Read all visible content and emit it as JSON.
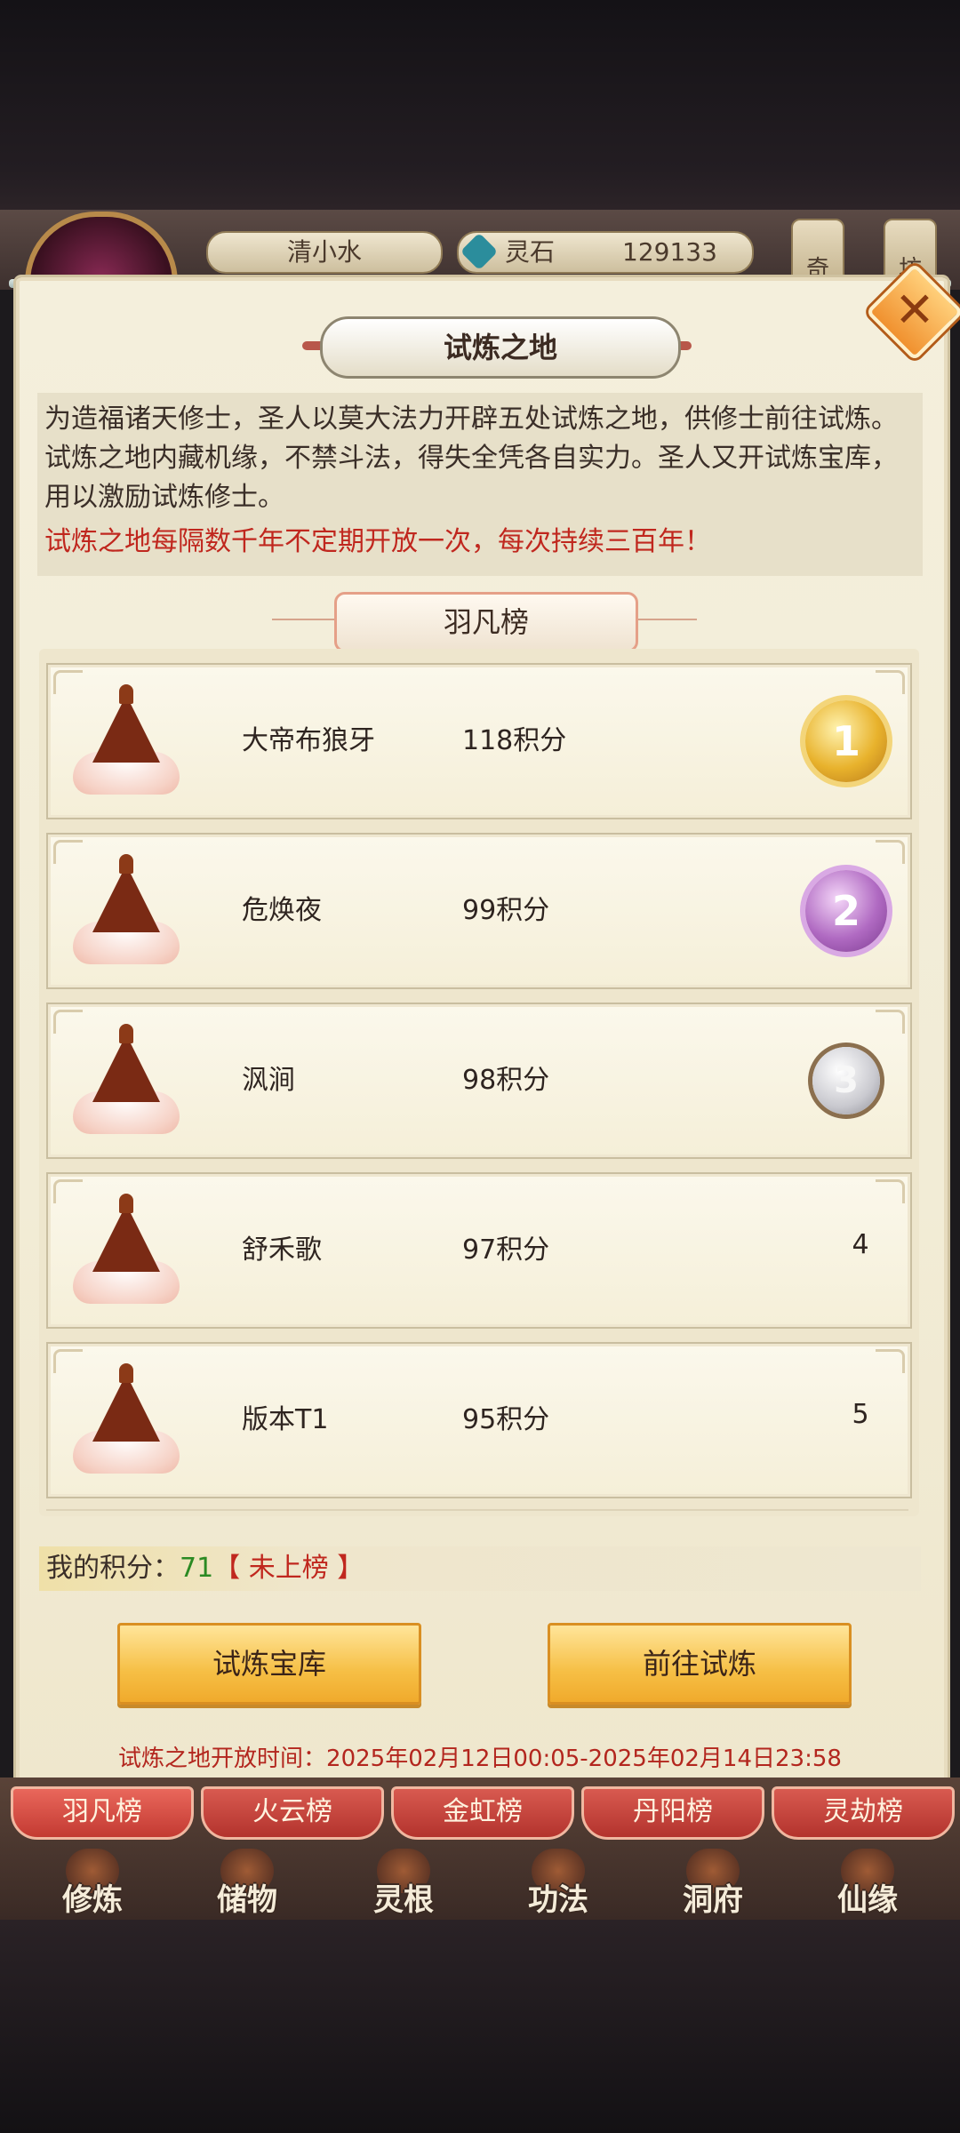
{
  "hud": {
    "player_name": "清小水",
    "currency_label": "灵石",
    "currency_value": "129133",
    "side_tabs": [
      "奇",
      "坊"
    ]
  },
  "modal": {
    "title": "试炼之地",
    "description": "为造福诸天修士，圣人以莫大法力开辟五处试炼之地，供修士前往试炼。试炼之地内藏机缘，不禁斗法，得失全凭各自实力。圣人又开试炼宝库，用以激励试炼修士。",
    "note": "试炼之地每隔数千年不定期开放一次，每次持续三百年！",
    "ranking_title": "羽凡榜",
    "rankings": [
      {
        "name": "大帝布狼牙",
        "score": "118积分",
        "rank": "1",
        "medal": "gold"
      },
      {
        "name": "危焕夜",
        "score": "99积分",
        "rank": "2",
        "medal": "purple"
      },
      {
        "name": "沨涧",
        "score": "98积分",
        "rank": "3",
        "medal": "silver"
      },
      {
        "name": "舒禾歌",
        "score": "97积分",
        "rank": "4",
        "medal": "none"
      },
      {
        "name": "版本T1",
        "score": "95积分",
        "rank": "5",
        "medal": "none"
      }
    ],
    "my_score_label": "我的积分：",
    "my_score_value": "71",
    "my_status": "【 未上榜 】",
    "buttons": {
      "treasury": "试炼宝库",
      "go_trial": "前往试炼"
    },
    "open_time": "试炼之地开放时间：2025年02月12日00:05-2025年02月14日23:58"
  },
  "board_tabs": [
    "羽凡榜",
    "火云榜",
    "金虹榜",
    "丹阳榜",
    "灵劫榜"
  ],
  "nav": [
    "修炼",
    "储物",
    "灵根",
    "功法",
    "洞府",
    "仙缘"
  ],
  "colors": {
    "accent_red": "#c0271e",
    "score_green": "#2b8a23",
    "button_gold": "#f6bf45",
    "medal_gold": "#e8b22c",
    "medal_purple": "#b06ac2",
    "medal_silver": "#c9c9cf"
  }
}
